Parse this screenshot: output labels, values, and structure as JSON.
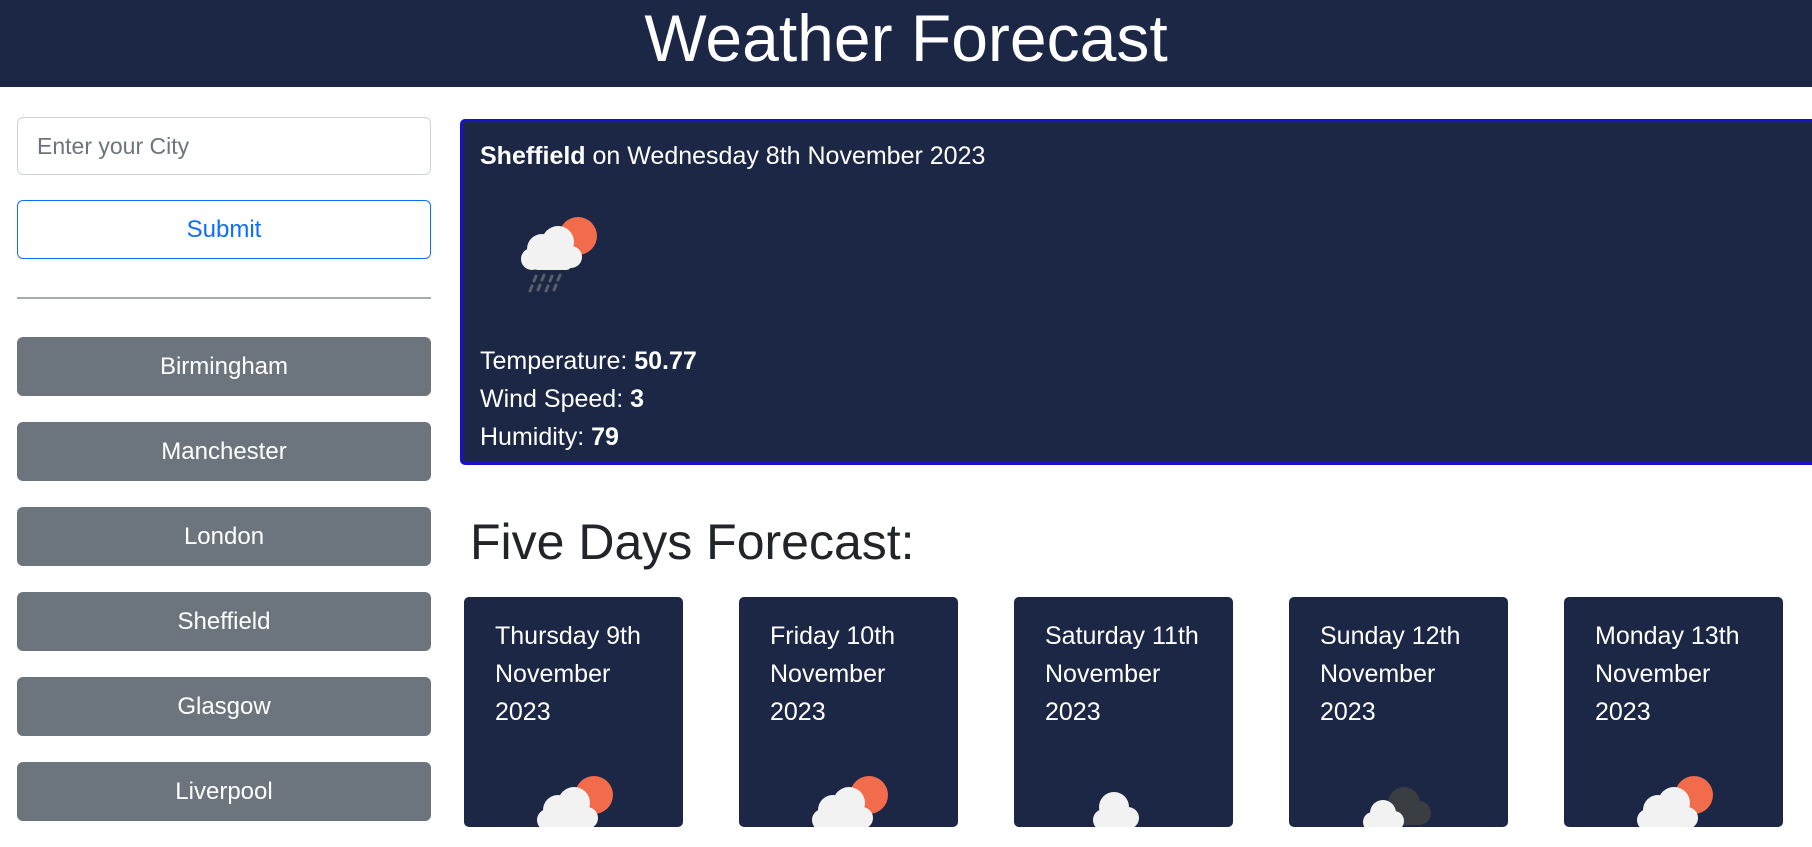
{
  "header": {
    "title": "Weather Forecast"
  },
  "search": {
    "placeholder": "Enter your City",
    "submit_label": "Submit"
  },
  "cities": [
    {
      "label": "Birmingham"
    },
    {
      "label": "Manchester"
    },
    {
      "label": "London"
    },
    {
      "label": "Sheffield"
    },
    {
      "label": "Glasgow"
    },
    {
      "label": "Liverpool"
    }
  ],
  "current": {
    "city": "Sheffield",
    "date_text": " on Wednesday 8th November 2023",
    "icon": "cloud-rain-sun-icon",
    "temperature_label": "Temperature: ",
    "temperature": "50.77",
    "wind_label": "Wind Speed: ",
    "wind": "3",
    "humidity_label": "Humidity: ",
    "humidity": "79"
  },
  "forecast": {
    "title": "Five Days Forecast:",
    "days": [
      {
        "date": "Thursday 9th November 2023",
        "icon": "cloud-sun-icon"
      },
      {
        "date": "Friday 10th November 2023",
        "icon": "cloud-sun-icon"
      },
      {
        "date": "Saturday 11th November 2023",
        "icon": "cloud-icon"
      },
      {
        "date": "Sunday 12th November 2023",
        "icon": "dark-cloud-icon"
      },
      {
        "date": "Monday 13th November 2023",
        "icon": "cloud-sun-icon"
      }
    ]
  },
  "colors": {
    "navy": "#1b2745",
    "sun": "#f26b4b",
    "city_button": "#6c757d",
    "primary": "#0d6efd"
  }
}
